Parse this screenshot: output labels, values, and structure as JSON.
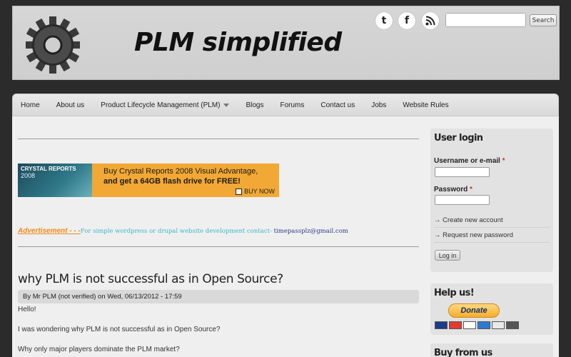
{
  "header": {
    "site_title": "PLM simplified",
    "logo_icon": "gear-logo-icon",
    "social": [
      {
        "name": "twitter-icon",
        "glyph": "t"
      },
      {
        "name": "facebook-icon",
        "glyph": "f"
      },
      {
        "name": "rss-icon",
        "glyph": "◔"
      }
    ],
    "search": {
      "placeholder": "",
      "value": "",
      "button_label": "Search"
    }
  },
  "nav": {
    "items": [
      {
        "label": "Home"
      },
      {
        "label": "About us"
      },
      {
        "label": "Product Lifecycle Management (PLM)",
        "has_dropdown": true
      },
      {
        "label": "Blogs"
      },
      {
        "label": "Forums"
      },
      {
        "label": "Contact us"
      },
      {
        "label": "Jobs"
      },
      {
        "label": "Website Rules"
      }
    ]
  },
  "ad_banner": {
    "brand": "CRYSTAL REPORTS",
    "year": "2008",
    "text_line1": "Buy Crystal Reports 2008 Visual Advantage,",
    "text_line2": "and get a 64GB flash drive for FREE!",
    "cta": "BUY NOW"
  },
  "advertisement": {
    "label": "Advertisement - - -",
    "contact_text": "For simple wordpress or drupal website development contact- ",
    "email": "timepassplz@gmail.com"
  },
  "post": {
    "title": "why PLM is not successful as in Open Source?",
    "meta": "By Mr PLM (not verified) on Wed, 06/13/2012 - 17:59",
    "lines": [
      "Hello!",
      "I was wondering why PLM is not successful as in Open Source?",
      "Why only major players dominate the PLM market?"
    ]
  },
  "sidebar": {
    "login": {
      "title": "User login",
      "username_label": "Username or e-mail",
      "password_label": "Password",
      "required_mark": "*",
      "links": [
        {
          "label": "Create new account"
        },
        {
          "label": "Request new password"
        }
      ],
      "button_label": "Log in"
    },
    "help": {
      "title": "Help us!",
      "donate_label": "Donate"
    },
    "buy": {
      "title": "Buy from us"
    }
  },
  "colors": {
    "background": "#2b2b2b",
    "accent_orange": "#f2a834",
    "required": "#c0392b"
  }
}
